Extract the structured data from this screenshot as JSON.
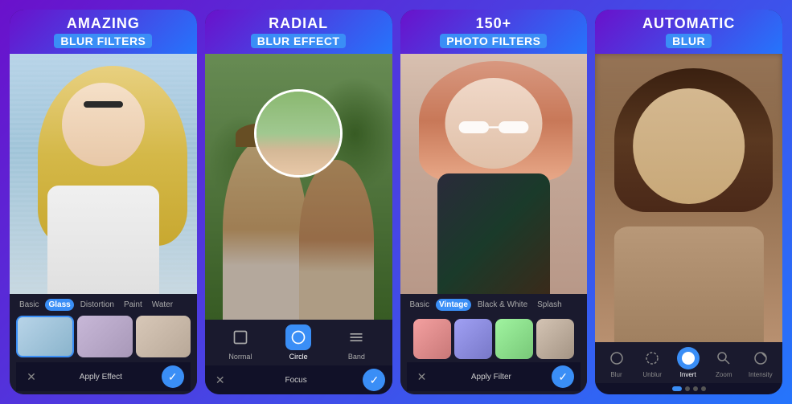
{
  "panels": [
    {
      "id": "panel-1",
      "title_main": "AMAZING",
      "title_sub": "BLUR FILTERS",
      "filter_tabs": [
        "Basic",
        "Glass",
        "Distortion",
        "Paint",
        "Water"
      ],
      "active_tab": "Glass",
      "apply_label": "Apply Effect",
      "shape_tabs": null
    },
    {
      "id": "panel-2",
      "title_main": "RADIAL",
      "title_sub": "BLUR EFFECT",
      "filter_tabs": null,
      "active_tab": null,
      "apply_label": null,
      "shape_tabs": [
        {
          "icon": "square",
          "label": "Normal",
          "active": false
        },
        {
          "icon": "circle",
          "label": "Circle",
          "active": true
        },
        {
          "icon": "band",
          "label": "Band",
          "active": false
        }
      ],
      "focus_label": "Focus"
    },
    {
      "id": "panel-3",
      "title_main": "150+",
      "title_sub": "PHOTO FILTERS",
      "filter_tabs": [
        "Basic",
        "Vintage",
        "Black & White",
        "Splash"
      ],
      "active_tab": "Vintage",
      "apply_label": "Apply Filter",
      "shape_tabs": null
    },
    {
      "id": "panel-4",
      "title_main": "AUTOMATIC",
      "title_sub": "BLUR",
      "tools": [
        {
          "label": "Blur",
          "active": false
        },
        {
          "label": "Unblur",
          "active": false
        },
        {
          "label": "Invert",
          "active": true
        },
        {
          "label": "Zoom",
          "active": false
        },
        {
          "label": "Intensity",
          "active": false
        }
      ]
    }
  ],
  "icons": {
    "close": "✕",
    "check": "✓",
    "blur_circle": "◎",
    "blur_tool": "○",
    "unblur_tool": "○",
    "invert_tool": "⬤",
    "zoom_tool": "🔍",
    "intensity_tool": "◐"
  }
}
